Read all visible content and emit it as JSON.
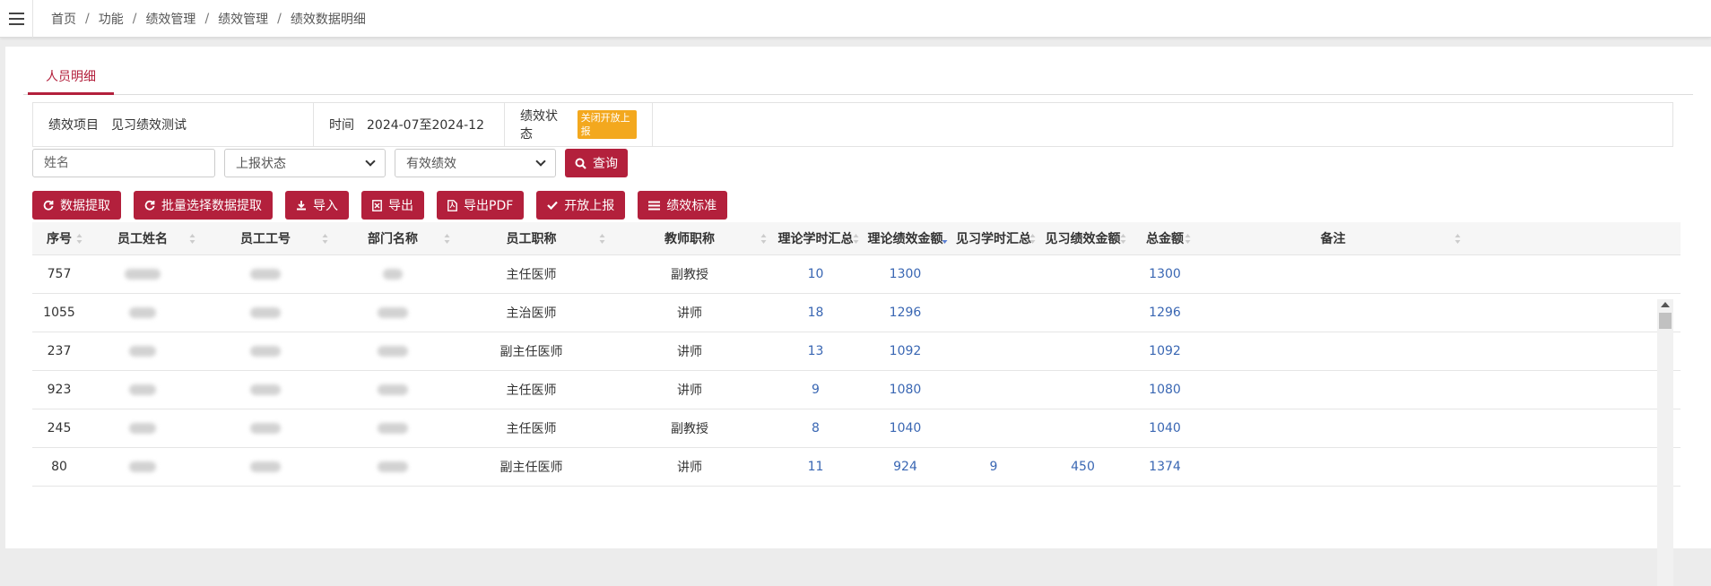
{
  "breadcrumb": [
    "首页",
    "功能",
    "绩效管理",
    "绩效管理",
    "绩效数据明细"
  ],
  "tab": "人员明细",
  "info": {
    "project_label": "绩效项目",
    "project_value": "见习绩效测试",
    "time_label": "时间",
    "time_value": "2024-07至2024-12",
    "status_label": "绩效状态",
    "status_badge": "关闭开放上报"
  },
  "filters": {
    "name_placeholder": "姓名",
    "report_status": "上报状态",
    "valid": "有效绩效",
    "query": "查询"
  },
  "actions": {
    "extract": "数据提取",
    "batch_extract": "批量选择数据提取",
    "import": "导入",
    "export": "导出",
    "export_pdf": "导出PDF",
    "open_report": "开放上报",
    "standard": "绩效标准"
  },
  "table": {
    "headers": [
      "序号",
      "员工姓名",
      "员工工号",
      "部门名称",
      "员工职称",
      "教师职称",
      "理论学时汇总",
      "理论绩效金额",
      "见习学时汇总",
      "见习绩效金额",
      "总金额",
      "备注"
    ],
    "rows": [
      {
        "seq": "757",
        "title": "主任医师",
        "teacher": "副教授",
        "th_hours": "10",
        "th_amount": "1300",
        "pr_hours": "",
        "pr_amount": "",
        "total": "1300"
      },
      {
        "seq": "1055",
        "title": "主治医师",
        "teacher": "讲师",
        "th_hours": "18",
        "th_amount": "1296",
        "pr_hours": "",
        "pr_amount": "",
        "total": "1296"
      },
      {
        "seq": "237",
        "title": "副主任医师",
        "teacher": "讲师",
        "th_hours": "13",
        "th_amount": "1092",
        "pr_hours": "",
        "pr_amount": "",
        "total": "1092"
      },
      {
        "seq": "923",
        "title": "主任医师",
        "teacher": "讲师",
        "th_hours": "9",
        "th_amount": "1080",
        "pr_hours": "",
        "pr_amount": "",
        "total": "1080"
      },
      {
        "seq": "245",
        "title": "主任医师",
        "teacher": "副教授",
        "th_hours": "8",
        "th_amount": "1040",
        "pr_hours": "",
        "pr_amount": "",
        "total": "1040"
      },
      {
        "seq": "80",
        "title": "副主任医师",
        "teacher": "讲师",
        "th_hours": "11",
        "th_amount": "924",
        "pr_hours": "9",
        "pr_amount": "450",
        "total": "1374"
      }
    ]
  },
  "colors": {
    "accent": "#b3203c",
    "number": "#3a67b3",
    "badge": "#f3a81e"
  }
}
